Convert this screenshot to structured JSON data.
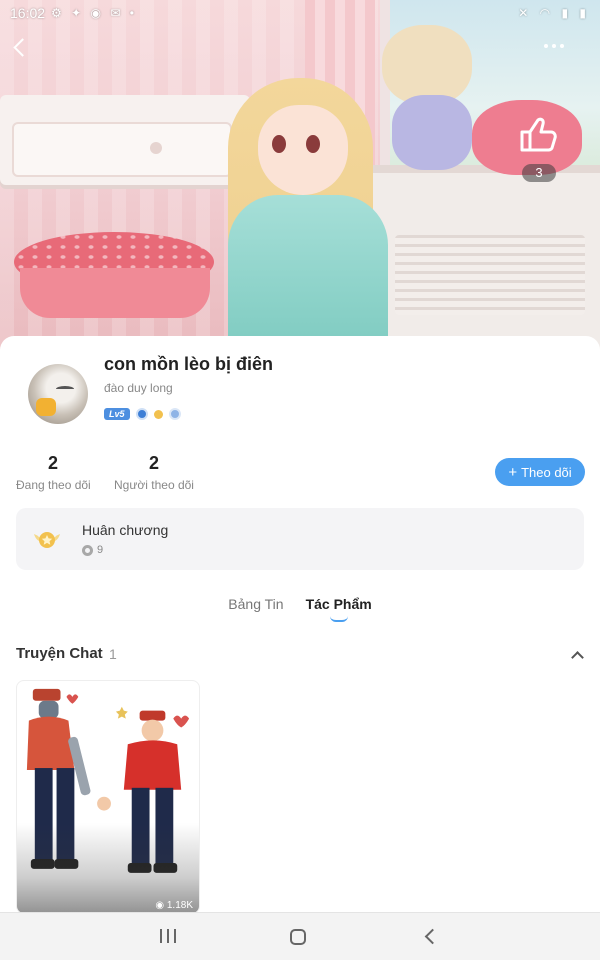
{
  "status_bar": {
    "time": "16:02",
    "left_icons": [
      "notification-icon",
      "sync-icon",
      "pinterest-icon",
      "gmail-icon",
      "dot-icon"
    ],
    "right_icons": [
      "mute-icon",
      "wifi-icon",
      "signal-icon",
      "battery-icon"
    ]
  },
  "header": {
    "like_count": "3"
  },
  "profile": {
    "name": "con mồn lèo bị điên",
    "subtitle": "đào duy long",
    "level_badge": "Lv5"
  },
  "stats": {
    "following_count": "2",
    "following_label": "Đang theo dõi",
    "followers_count": "2",
    "followers_label": "Người theo dõi"
  },
  "follow_button": {
    "label": "Theo dõi"
  },
  "medal": {
    "title": "Huân chương",
    "count": "9"
  },
  "tabs": [
    {
      "label": "Bảng Tin",
      "active": false
    },
    {
      "label": "Tác Phẩm",
      "active": true
    }
  ],
  "section": {
    "title": "Truyện Chat",
    "count": "1"
  },
  "story": {
    "views": "1.18K"
  },
  "colors": {
    "accent": "#4a9ff0",
    "level_badge": "#4d8fe0",
    "medal": "#f2c14e"
  }
}
